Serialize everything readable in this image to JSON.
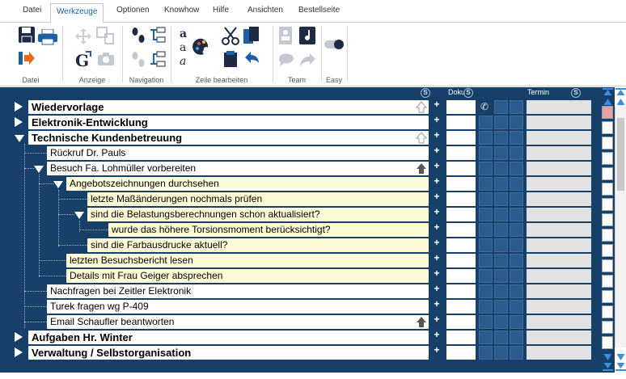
{
  "menu": {
    "tabs": [
      "Datei",
      "Werkzeuge",
      "Optionen",
      "Knowhow",
      "Hilfe",
      "Ansichten",
      "Bestellseite"
    ],
    "active": "Werkzeuge"
  },
  "ribbon": {
    "groups": [
      "Datei",
      "Anzeige",
      "Navigation",
      "Zeile bearbeiten",
      "Team",
      "Easy"
    ]
  },
  "tree": {
    "header": {
      "doku": "Doku",
      "termin": "Termin",
      "s": "S"
    },
    "rows": [
      {
        "label": "Wiedervorlage",
        "bold": true
      },
      {
        "label": "Elektronik-Entwicklung",
        "bold": true
      },
      {
        "label": "Technische Kundenbetreuung",
        "bold": true
      },
      {
        "label": "Rückruf Dr. Pauls"
      },
      {
        "label": "Besuch Fa. Lohmüller vorbereiten"
      },
      {
        "label": "Angebotszeichnungen durchsehen"
      },
      {
        "label": "letzte Maßänderungen nochmals prüfen"
      },
      {
        "label": "sind die Belastungsberechnungen schon aktualisiert?"
      },
      {
        "label": "wurde das höhere Torsionsmoment berücksichtigt?"
      },
      {
        "label": "sind die Farbausdrucke aktuell?"
      },
      {
        "label": "letzten Besuchsbericht lesen"
      },
      {
        "label": "Details mit Frau Geiger absprechen"
      },
      {
        "label": "Nachfragen bei Zeitler Elektronik"
      },
      {
        "label": "Turek fragen wg P-409"
      },
      {
        "label": "Email Schaufler beantworten"
      },
      {
        "label": "Aufgaben Hr. Winter",
        "bold": true
      },
      {
        "label": "Verwaltung / Selbstorganisation",
        "bold": true
      }
    ],
    "plus": "+"
  },
  "colors": {
    "tree_bg": "#174068",
    "yellow_row": "#fffbd6",
    "cell": "#2c5a8c",
    "termin": "#e2e2e2",
    "accent_tab": "#1c5fb0"
  },
  "icons": {
    "save": "save-icon",
    "print": "print-icon",
    "exit": "exit-icon",
    "arrows": "move-icon",
    "goto": "goto-icon",
    "camera": "camera-icon",
    "footprints": "footprints-icon",
    "tree": "tree-view-icon",
    "font": "font-icon",
    "palette": "palette-icon",
    "cut": "cut-icon",
    "copy": "copy-icon",
    "paste": "paste-icon",
    "undo": "undo-icon",
    "contacts": "contacts-icon",
    "music": "assign-icon",
    "chat": "chat-icon",
    "share": "share-icon",
    "toggle": "toggle-icon"
  }
}
